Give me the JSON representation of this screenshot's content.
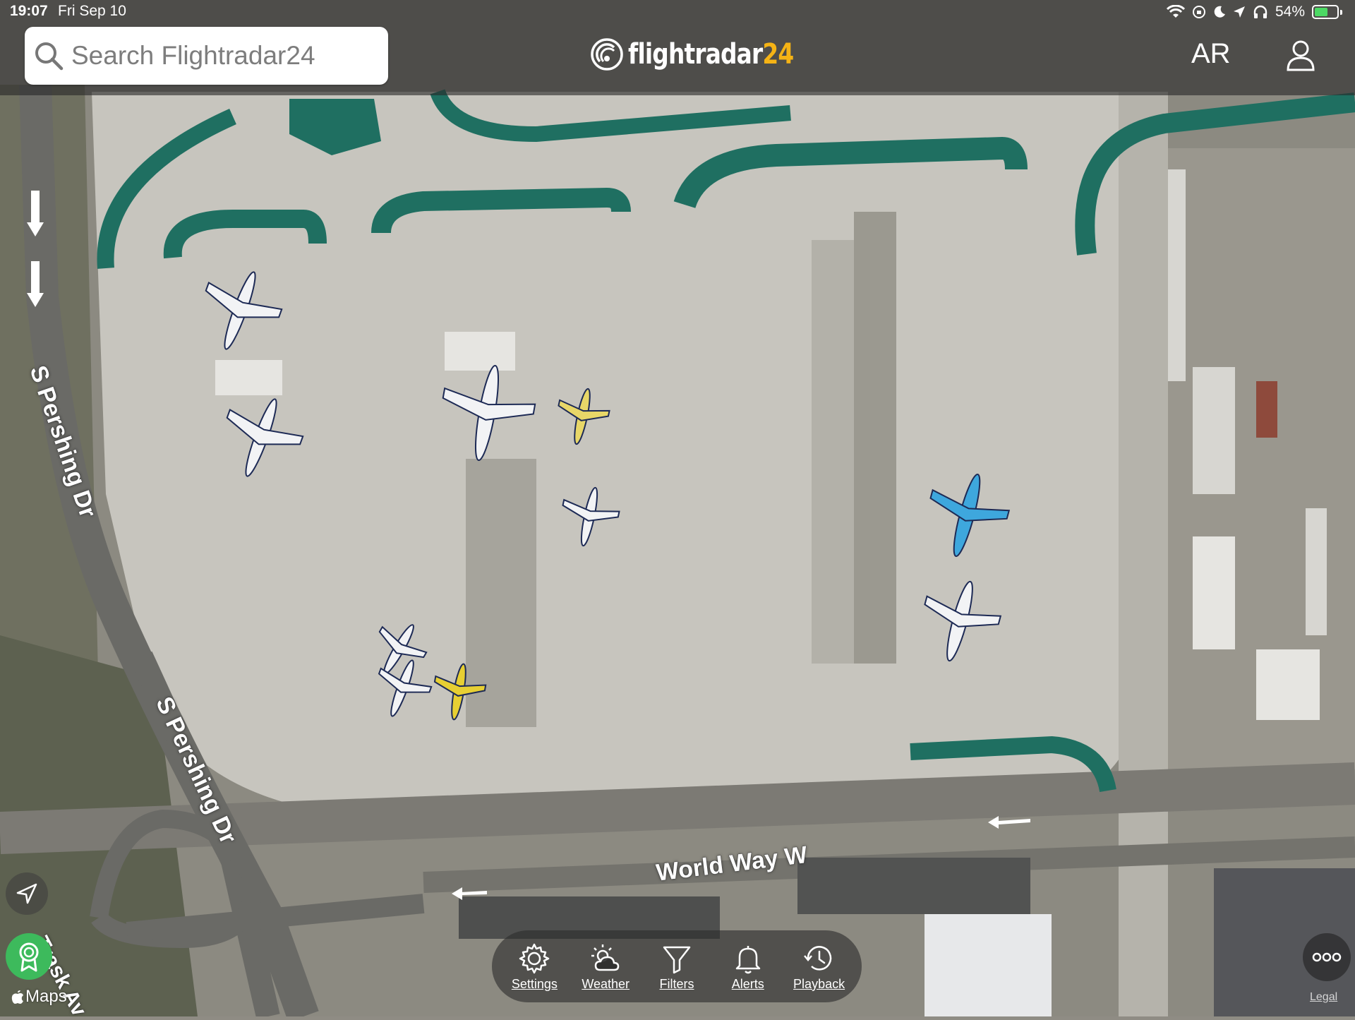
{
  "status_bar": {
    "time": "19:07",
    "date": "Fri Sep 10",
    "battery": "54%"
  },
  "search": {
    "placeholder": "Search Flightradar24"
  },
  "logo": {
    "text": "flightradar",
    "number": "24"
  },
  "header": {
    "ar_label": "AR"
  },
  "map_labels": {
    "road_1": "S Pershing Dr",
    "road_2": "S Pershing Dr",
    "road_3": "World Way W",
    "road_4": "Trask Av"
  },
  "toolbar": {
    "settings": "Settings",
    "weather": "Weather",
    "filters": "Filters",
    "alerts": "Alerts",
    "playback": "Playback"
  },
  "footer": {
    "maps": "Maps",
    "legal": "Legal"
  },
  "colors": {
    "accent": "#f5b315",
    "badge": "#3dba5c",
    "apron_green": "#1f6f61"
  }
}
